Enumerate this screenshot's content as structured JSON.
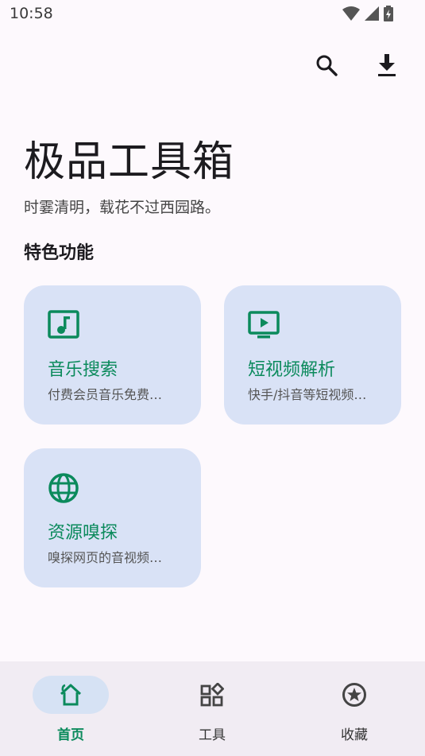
{
  "status": {
    "time": "10:58"
  },
  "header": {
    "search_icon": "search-icon",
    "download_icon": "download-icon"
  },
  "main": {
    "title": "极品工具箱",
    "subtitle": "时霎清明，载花不过西园路。",
    "section_title": "特色功能",
    "cards": [
      {
        "title": "音乐搜索",
        "desc": "付费会员音乐免费…",
        "icon": "music-note-icon"
      },
      {
        "title": "短视频解析",
        "desc": "快手/抖音等短视频…",
        "icon": "video-play-icon"
      },
      {
        "title": "资源嗅探",
        "desc": "嗅探网页的音视频…",
        "icon": "globe-icon"
      }
    ]
  },
  "bottom_nav": {
    "items": [
      {
        "label": "首页",
        "icon": "home-icon",
        "active": true
      },
      {
        "label": "工具",
        "icon": "widgets-icon",
        "active": false
      },
      {
        "label": "收藏",
        "icon": "star-circle-icon",
        "active": false
      }
    ]
  },
  "colors": {
    "accent": "#0b8a5c",
    "card_bg": "#d9e2f6",
    "nav_bg": "#f1ecf3",
    "page_bg": "#fdf9fd"
  }
}
